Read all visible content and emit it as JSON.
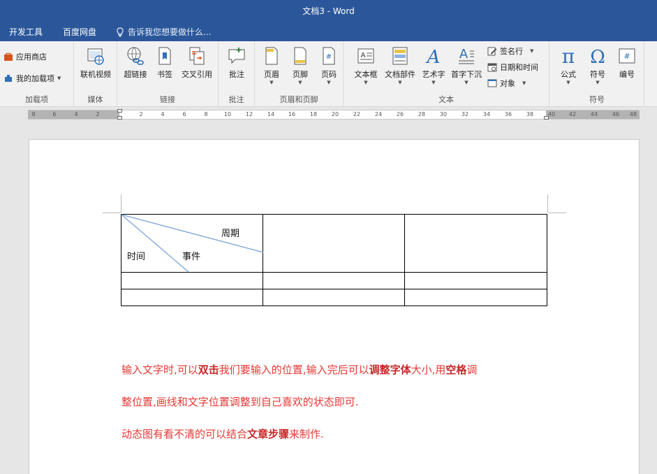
{
  "window": {
    "title": "文档3 - Word"
  },
  "tabs": {
    "items": [
      "开发工具",
      "百度网盘"
    ],
    "tell_me": "告诉我您想要做什么..."
  },
  "ribbon": {
    "addins": {
      "store": "应用商店",
      "my_addins": "我的加载项",
      "group": "加载项"
    },
    "media": {
      "online_video": "联机视频",
      "group": "媒体"
    },
    "links": {
      "hyperlink": "超链接",
      "bookmark": "书签",
      "cross_ref": "交叉引用",
      "group": "链接"
    },
    "comments": {
      "comment": "批注",
      "group": "批注"
    },
    "header_footer": {
      "header": "页眉",
      "footer": "页脚",
      "page_number": "页码",
      "group": "页眉和页脚"
    },
    "text": {
      "textbox": "文本框",
      "quick_parts": "文档部件",
      "wordart": "艺术字",
      "dropcap": "首字下沉",
      "signature_line": "签名行",
      "date_time": "日期和时间",
      "object": "对象",
      "group": "文本"
    },
    "symbols": {
      "equation": "公式",
      "symbol": "符号",
      "number": "编号",
      "group": "符号"
    }
  },
  "ruler": {
    "ticks": [
      "8",
      "6",
      "4",
      "2",
      "2",
      "4",
      "6",
      "8",
      "10",
      "12",
      "14",
      "16",
      "18",
      "20",
      "22",
      "24",
      "26",
      "28",
      "30",
      "32",
      "34",
      "36",
      "38",
      "40",
      "42",
      "44",
      "46",
      "48"
    ]
  },
  "document": {
    "table": {
      "header_period": "周期",
      "header_event": "事件",
      "header_time": "时间"
    },
    "paragraph": {
      "line1": {
        "a": "输入文字时,可以",
        "b": "双击",
        "c": "我们要输入的位置,输入完后可以",
        "d": "调整字体",
        "e": "大小,用",
        "f": "空格",
        "g": "调"
      },
      "line2": "整位置,画线和文字位置调整到自己喜欢的状态即可.",
      "line3": {
        "a": "动态图有看不清的可以结合",
        "b": "文章步骤",
        "c": "来制作."
      }
    }
  },
  "colors": {
    "accent": "#2b579a",
    "text_red": "#e53935"
  }
}
